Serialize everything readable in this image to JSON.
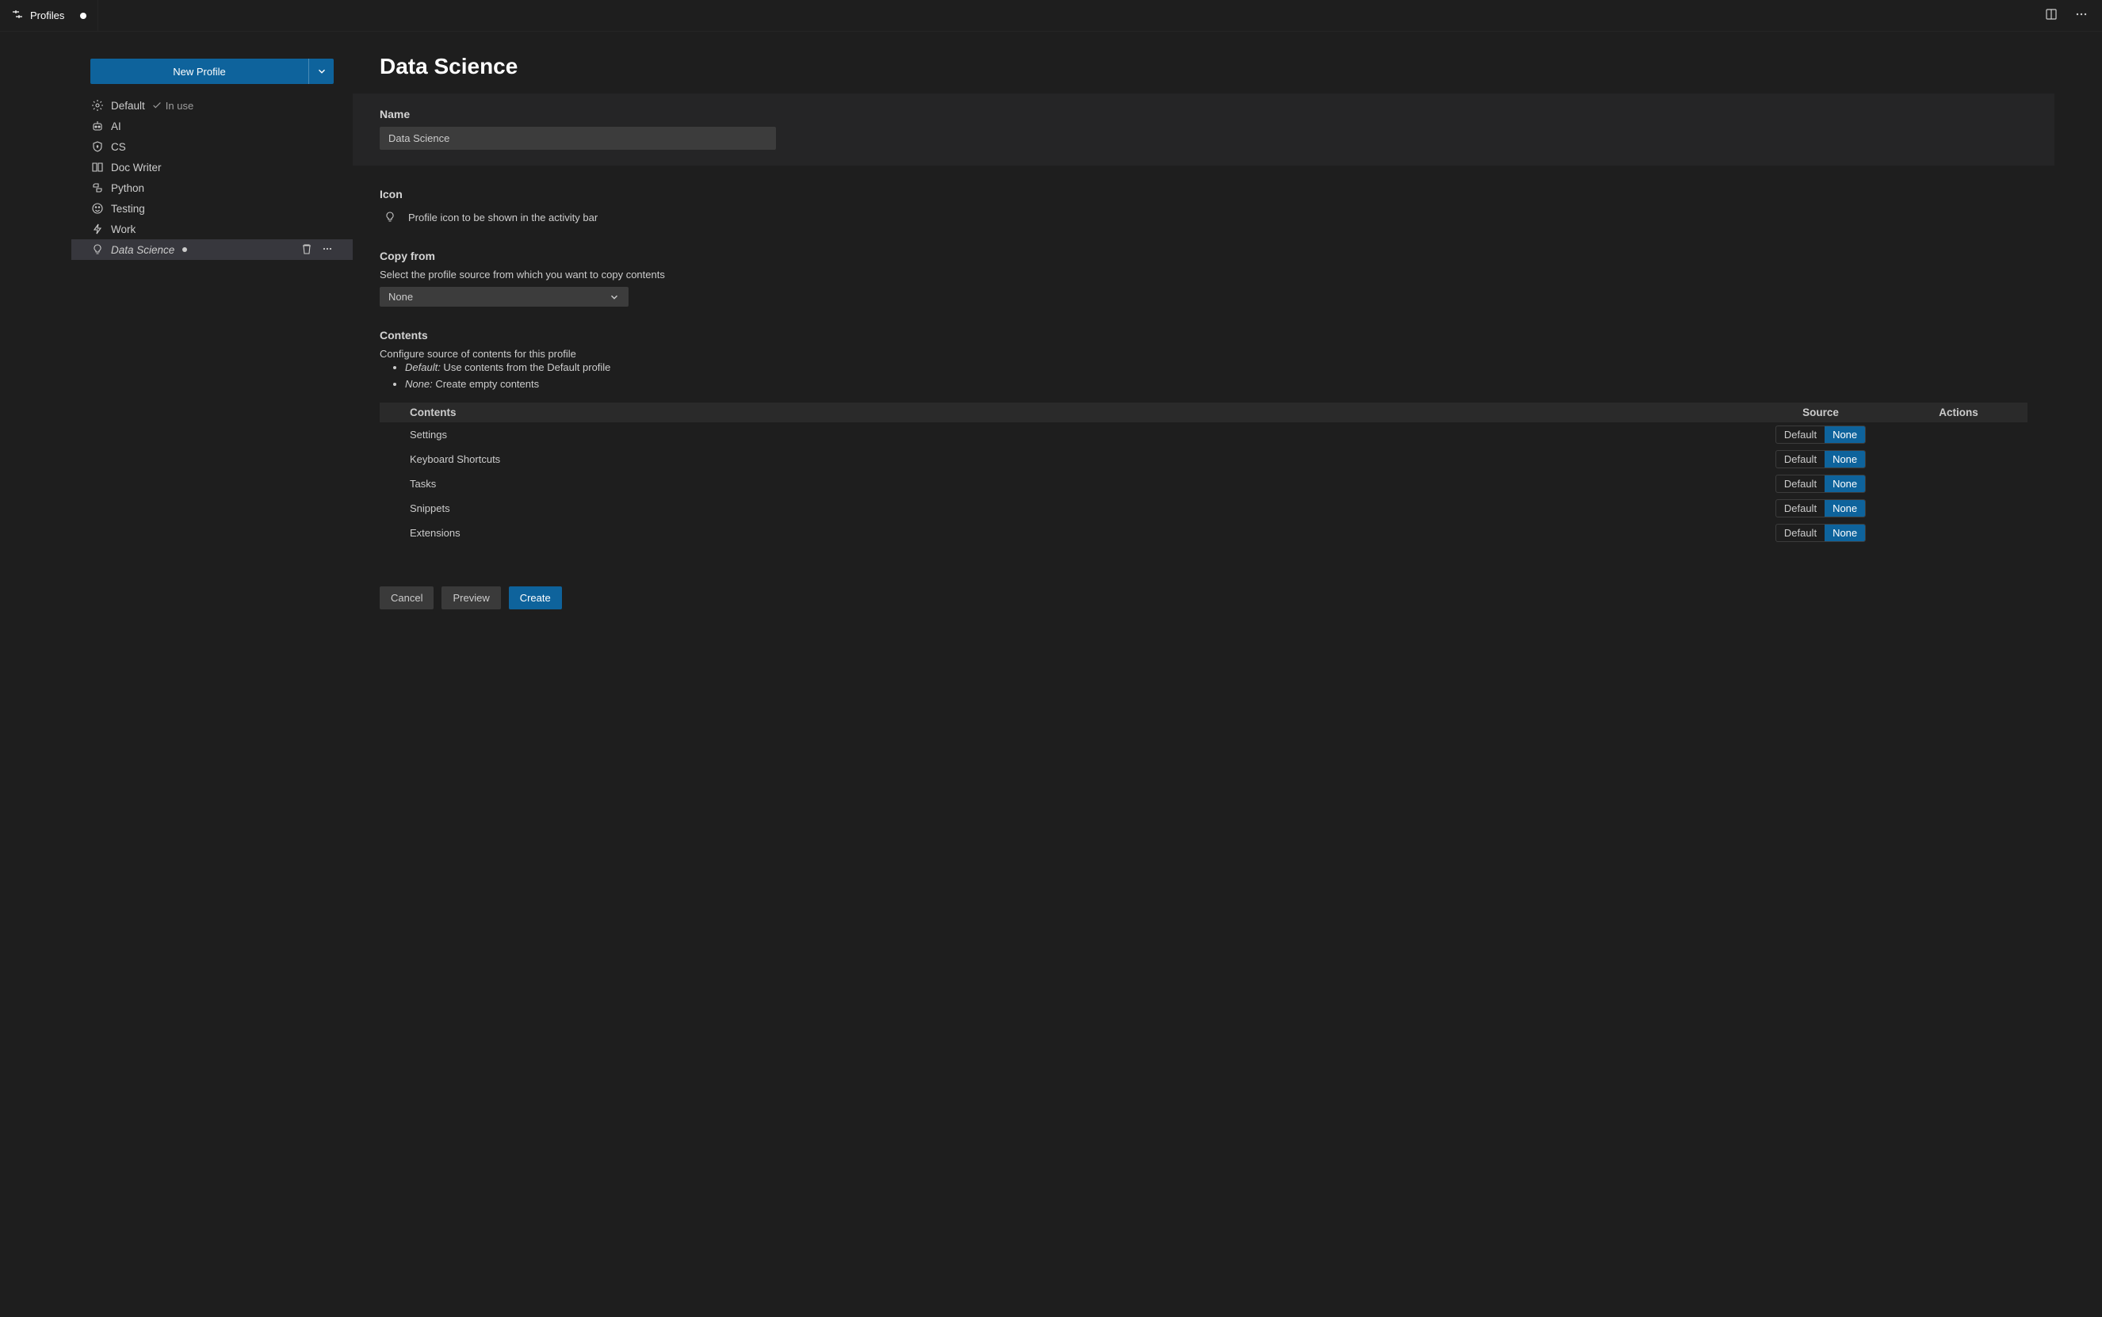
{
  "tab": {
    "label": "Profiles"
  },
  "sidebar": {
    "newProfileLabel": "New Profile",
    "inUseLabel": "In use",
    "items": [
      {
        "name": "Default",
        "icon": "gear",
        "inUse": true
      },
      {
        "name": "AI",
        "icon": "robot"
      },
      {
        "name": "CS",
        "icon": "shield"
      },
      {
        "name": "Doc Writer",
        "icon": "book"
      },
      {
        "name": "Python",
        "icon": "snake"
      },
      {
        "name": "Testing",
        "icon": "smiley"
      },
      {
        "name": "Work",
        "icon": "zap"
      },
      {
        "name": "Data Science",
        "icon": "lightbulb",
        "dirty": true,
        "selected": true
      }
    ]
  },
  "main": {
    "title": "Data Science",
    "nameLabel": "Name",
    "nameValue": "Data Science",
    "iconLabel": "Icon",
    "iconHint": "Profile icon to be shown in the activity bar",
    "copyFromLabel": "Copy from",
    "copyFromHint": "Select the profile source from which you want to copy contents",
    "copyFromValue": "None",
    "contentsLabel": "Contents",
    "contentsHint": "Configure source of contents for this profile",
    "bullets": {
      "defaultTerm": "Default:",
      "defaultText": " Use contents from the Default profile",
      "noneTerm": "None:",
      "noneText": " Create empty contents"
    },
    "table": {
      "headers": {
        "c1": "Contents",
        "c2": "Source",
        "c3": "Actions"
      },
      "toggle": {
        "opt1": "Default",
        "opt2": "None"
      },
      "rows": [
        {
          "name": "Settings",
          "source": "None"
        },
        {
          "name": "Keyboard Shortcuts",
          "source": "None"
        },
        {
          "name": "Tasks",
          "source": "None"
        },
        {
          "name": "Snippets",
          "source": "None"
        },
        {
          "name": "Extensions",
          "source": "None"
        }
      ]
    },
    "buttons": {
      "cancel": "Cancel",
      "preview": "Preview",
      "create": "Create"
    }
  }
}
